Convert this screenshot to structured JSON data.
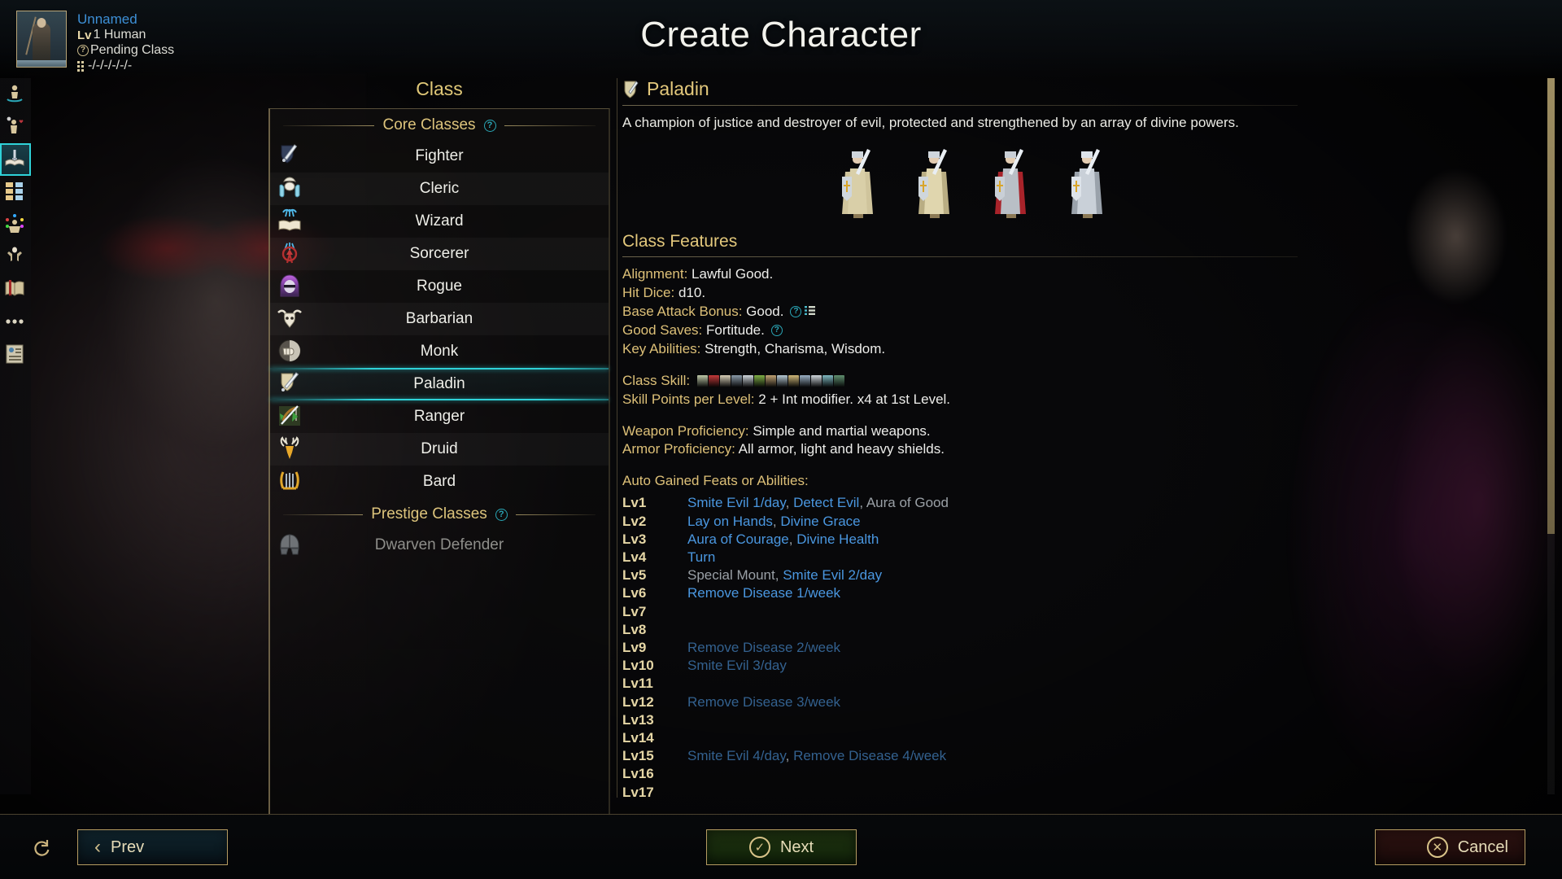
{
  "header": {
    "title": "Create Character"
  },
  "portrait": {
    "name": "Unnamed",
    "level_prefix": "Lv",
    "level_race": "1 Human",
    "class_status": "Pending Class",
    "stats": "-/-/-/-/-/-"
  },
  "rail": {
    "items": [
      {
        "name": "rail-item-race",
        "icon": "body-in-fountain-icon",
        "selected": false
      },
      {
        "name": "rail-item-background",
        "icon": "person-thought-heart-icon",
        "selected": false
      },
      {
        "name": "rail-item-class",
        "icon": "sword-over-book-icon",
        "selected": true
      },
      {
        "name": "rail-item-attributes",
        "icon": "color-grid-icon",
        "selected": false
      },
      {
        "name": "rail-item-skills",
        "icon": "juggler-icon",
        "selected": false
      },
      {
        "name": "rail-item-body",
        "icon": "flexing-figure-icon",
        "selected": false
      },
      {
        "name": "rail-item-spells",
        "icon": "open-book-bookmark-icon",
        "selected": false
      },
      {
        "name": "rail-item-more",
        "icon": "ellipsis-icon",
        "selected": false
      },
      {
        "name": "rail-item-summary",
        "icon": "character-sheet-icon",
        "selected": false
      }
    ]
  },
  "class_column": {
    "heading": "Class",
    "core_section_label": "Core Classes",
    "prestige_section_label": "Prestige Classes",
    "core_classes": [
      {
        "label": "Fighter",
        "icon": "sword-shield-icon"
      },
      {
        "label": "Cleric",
        "icon": "hands-holy-symbol-icon"
      },
      {
        "label": "Wizard",
        "icon": "spellbook-icon"
      },
      {
        "label": "Sorcerer",
        "icon": "bloodline-magic-icon"
      },
      {
        "label": "Rogue",
        "icon": "hooded-masked-icon"
      },
      {
        "label": "Barbarian",
        "icon": "bull-skull-icon"
      },
      {
        "label": "Monk",
        "icon": "fist-icon"
      },
      {
        "label": "Paladin",
        "icon": "shield-sword-icon"
      },
      {
        "label": "Ranger",
        "icon": "bow-arrow-icon"
      },
      {
        "label": "Druid",
        "icon": "antlers-icon"
      },
      {
        "label": "Bard",
        "icon": "lyre-icon"
      }
    ],
    "selected_class": "Paladin",
    "prestige_classes": [
      {
        "label": "Dwarven Defender",
        "icon": "dwarf-helm-icon",
        "disabled": true
      }
    ]
  },
  "detail": {
    "class_name": "Paladin",
    "icon": "shield-sword-icon",
    "description": "A champion of justice and destroyer of evil, protected and strengthened by an array of divine powers.",
    "features_heading": "Class Features",
    "features": [
      {
        "key": "Alignment:",
        "value": "Lawful Good.",
        "help": false,
        "list": false
      },
      {
        "key": "Hit Dice:",
        "value": "d10.",
        "help": false,
        "list": false
      },
      {
        "key": "Base Attack Bonus:",
        "value": "Good.",
        "help": true,
        "list": true
      },
      {
        "key": "Good Saves:",
        "value": "Fortitude.",
        "help": true,
        "list": false
      },
      {
        "key": "Key Abilities:",
        "value": "Strength, Charisma, Wisdom.",
        "help": false,
        "list": false
      }
    ],
    "class_skill_label": "Class Skill:",
    "skill_points_key": "Skill Points per Level:",
    "skill_points_value": "2 + Int modifier. x4 at 1st Level.",
    "weapon_prof_key": "Weapon Proficiency:",
    "weapon_prof_value": "Simple and martial weapons.",
    "armor_prof_key": "Armor Proficiency:",
    "armor_prof_value": "All armor, light and heavy shields.",
    "auto_gained_heading": "Auto Gained Feats or Abilities:",
    "levels": [
      {
        "lv": "Lv1",
        "parts": [
          {
            "t": "Smite Evil 1/day",
            "s": "link"
          },
          {
            "t": ", ",
            "s": "plain"
          },
          {
            "t": "Detect Evil",
            "s": "link"
          },
          {
            "t": ", ",
            "s": "plain"
          },
          {
            "t": "Aura of Good",
            "s": "plain"
          }
        ]
      },
      {
        "lv": "Lv2",
        "parts": [
          {
            "t": "Lay on Hands",
            "s": "link"
          },
          {
            "t": ", ",
            "s": "plain"
          },
          {
            "t": "Divine Grace",
            "s": "link"
          }
        ]
      },
      {
        "lv": "Lv3",
        "parts": [
          {
            "t": "Aura of Courage",
            "s": "link"
          },
          {
            "t": ", ",
            "s": "plain"
          },
          {
            "t": "Divine Health",
            "s": "link"
          }
        ]
      },
      {
        "lv": "Lv4",
        "parts": [
          {
            "t": "Turn",
            "s": "link"
          }
        ]
      },
      {
        "lv": "Lv5",
        "parts": [
          {
            "t": "Special Mount",
            "s": "plain"
          },
          {
            "t": ", ",
            "s": "plain"
          },
          {
            "t": "Smite Evil 2/day",
            "s": "link"
          }
        ]
      },
      {
        "lv": "Lv6",
        "parts": [
          {
            "t": "Remove Disease 1/week",
            "s": "link"
          }
        ]
      },
      {
        "lv": "Lv7",
        "parts": []
      },
      {
        "lv": "Lv8",
        "parts": []
      },
      {
        "lv": "Lv9",
        "parts": [
          {
            "t": "Remove Disease 2/week",
            "s": "dim"
          }
        ]
      },
      {
        "lv": "Lv10",
        "parts": [
          {
            "t": "Smite Evil 3/day",
            "s": "dim"
          }
        ]
      },
      {
        "lv": "Lv11",
        "parts": []
      },
      {
        "lv": "Lv12",
        "parts": [
          {
            "t": "Remove Disease 3/week",
            "s": "dim"
          }
        ]
      },
      {
        "lv": "Lv13",
        "parts": []
      },
      {
        "lv": "Lv14",
        "parts": []
      },
      {
        "lv": "Lv15",
        "parts": [
          {
            "t": "Smite Evil 4/day",
            "s": "dim"
          },
          {
            "t": ", ",
            "s": "plain"
          },
          {
            "t": "Remove Disease 4/week",
            "s": "dim"
          }
        ]
      },
      {
        "lv": "Lv16",
        "parts": []
      },
      {
        "lv": "Lv17",
        "parts": []
      }
    ]
  },
  "footer": {
    "reset_icon": "reset-icon",
    "prev_label": "Prev",
    "next_label": "Next",
    "cancel_label": "Cancel"
  },
  "colors": {
    "accent_gold": "#e0c878",
    "accent_cyan": "#2fd2d8",
    "link_blue": "#4a97e0",
    "link_dim": "#33618f",
    "name_blue": "#3d8fd6"
  }
}
